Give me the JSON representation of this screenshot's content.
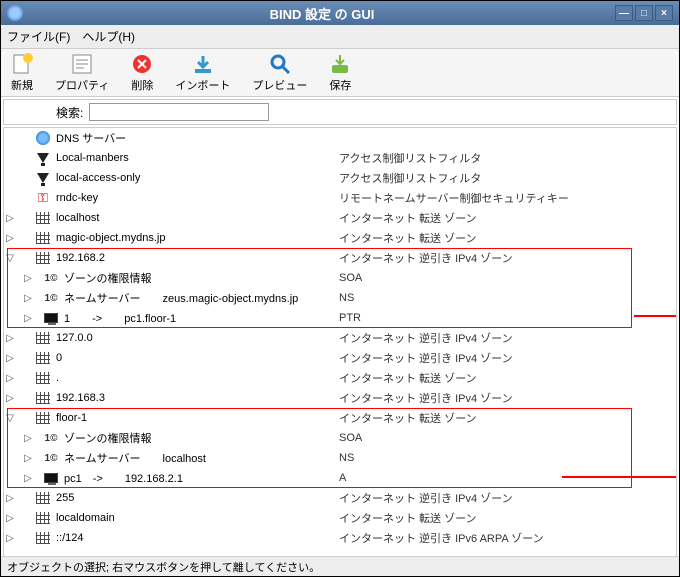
{
  "window": {
    "title": "BIND 設定 の GUI"
  },
  "menu": {
    "file": "ファイル(F)",
    "help": "ヘルプ(H)"
  },
  "toolbar": {
    "new": "新規",
    "properties": "プロパティ",
    "delete": "削除",
    "import": "インボート",
    "preview": "プレビュー",
    "save": "保存"
  },
  "search": {
    "label": "検索:"
  },
  "tree": {
    "items": [
      {
        "depth": 0,
        "exp": "",
        "icon": "globe",
        "label": "DNS サーバー",
        "desc": ""
      },
      {
        "depth": 0,
        "exp": "",
        "icon": "funnel",
        "label": "Local-manbers",
        "desc": "アクセス制御リストフィルタ"
      },
      {
        "depth": 0,
        "exp": "",
        "icon": "funnel",
        "label": "local-access-only",
        "desc": "アクセス制御リストフィルタ"
      },
      {
        "depth": 0,
        "exp": "",
        "icon": "key",
        "label": "rndc-key",
        "desc": "リモートネームサーバー制御セキュリティキー"
      },
      {
        "depth": 0,
        "exp": "▷",
        "icon": "zone",
        "label": "localhost",
        "desc": "インターネット 転送 ゾーン"
      },
      {
        "depth": 0,
        "exp": "▷",
        "icon": "zone",
        "label": "magic-object.mydns.jp",
        "desc": "インターネット 転送 ゾーン"
      },
      {
        "depth": 0,
        "exp": "▽",
        "icon": "zone",
        "label": "192.168.2",
        "desc": "インターネット 逆引き IPv4 ゾーン"
      },
      {
        "depth": 1,
        "exp": "▷",
        "icon": "rec",
        "label": "ゾーンの権限情報",
        "desc": "SOA"
      },
      {
        "depth": 1,
        "exp": "▷",
        "icon": "rec",
        "label": "ネームサーバー　　zeus.magic-object.mydns.jp",
        "desc": "NS"
      },
      {
        "depth": 1,
        "exp": "▷",
        "icon": "pc",
        "label": "1　　->　　pc1.floor-1",
        "desc": "PTR"
      },
      {
        "depth": 0,
        "exp": "▷",
        "icon": "zone",
        "label": "127.0.0",
        "desc": "インターネット 逆引き IPv4 ゾーン"
      },
      {
        "depth": 0,
        "exp": "▷",
        "icon": "zone",
        "label": "0",
        "desc": "インターネット 逆引き IPv4 ゾーン"
      },
      {
        "depth": 0,
        "exp": "▷",
        "icon": "zone",
        "label": ".",
        "desc": "インターネット 転送 ゾーン"
      },
      {
        "depth": 0,
        "exp": "▷",
        "icon": "zone",
        "label": "192.168.3",
        "desc": "インターネット 逆引き IPv4 ゾーン"
      },
      {
        "depth": 0,
        "exp": "▽",
        "icon": "zone",
        "label": "floor-1",
        "desc": "インターネット 転送 ゾーン"
      },
      {
        "depth": 1,
        "exp": "▷",
        "icon": "rec",
        "label": "ゾーンの権限情報",
        "desc": "SOA"
      },
      {
        "depth": 1,
        "exp": "▷",
        "icon": "rec",
        "label": "ネームサーバー　　localhost",
        "desc": "NS"
      },
      {
        "depth": 1,
        "exp": "▷",
        "icon": "pc",
        "label": "pc1　->　　192.168.2.1",
        "desc": "A"
      },
      {
        "depth": 0,
        "exp": "▷",
        "icon": "zone",
        "label": "255",
        "desc": "インターネット 逆引き IPv4 ゾーン"
      },
      {
        "depth": 0,
        "exp": "▷",
        "icon": "zone",
        "label": "localdomain",
        "desc": "インターネット 転送 ゾーン"
      },
      {
        "depth": 0,
        "exp": "▷",
        "icon": "zone",
        "label": "::/124",
        "desc": "インターネット 逆引き IPv6 ARPA ゾーン"
      }
    ]
  },
  "status": {
    "text": "オブジェクトの選択; 右マウスボタンを押して離してください。"
  }
}
